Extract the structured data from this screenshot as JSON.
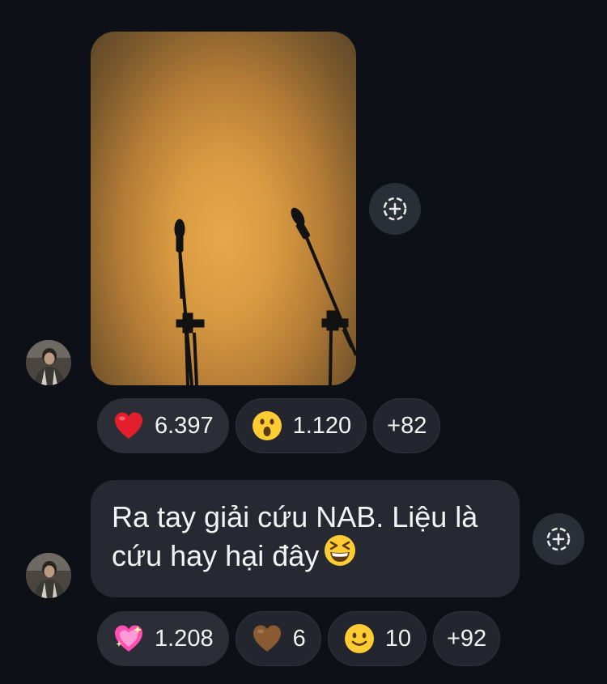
{
  "messages": [
    {
      "type": "photo",
      "reactions": [
        {
          "emoji": "red-heart",
          "count": "6.397"
        },
        {
          "emoji": "astonished-face",
          "count": "1.120"
        },
        {
          "more": "+82"
        }
      ]
    },
    {
      "type": "text",
      "text": "Ra tay giải cứu NAB. Liệu là cứu hay hại đây",
      "emoji": "grinning-squinting-face",
      "reactions": [
        {
          "emoji": "sparkling-heart",
          "count": "1.208"
        },
        {
          "emoji": "brown-heart",
          "count": "6"
        },
        {
          "emoji": "slightly-smiling-face",
          "count": "10"
        },
        {
          "more": "+92"
        }
      ]
    }
  ],
  "colors": {
    "background": "#0d1117",
    "bubble": "#262931",
    "reaction_pill": "#23262e",
    "text": "#f2f3f5",
    "photo_backdrop": "#d89a41"
  }
}
